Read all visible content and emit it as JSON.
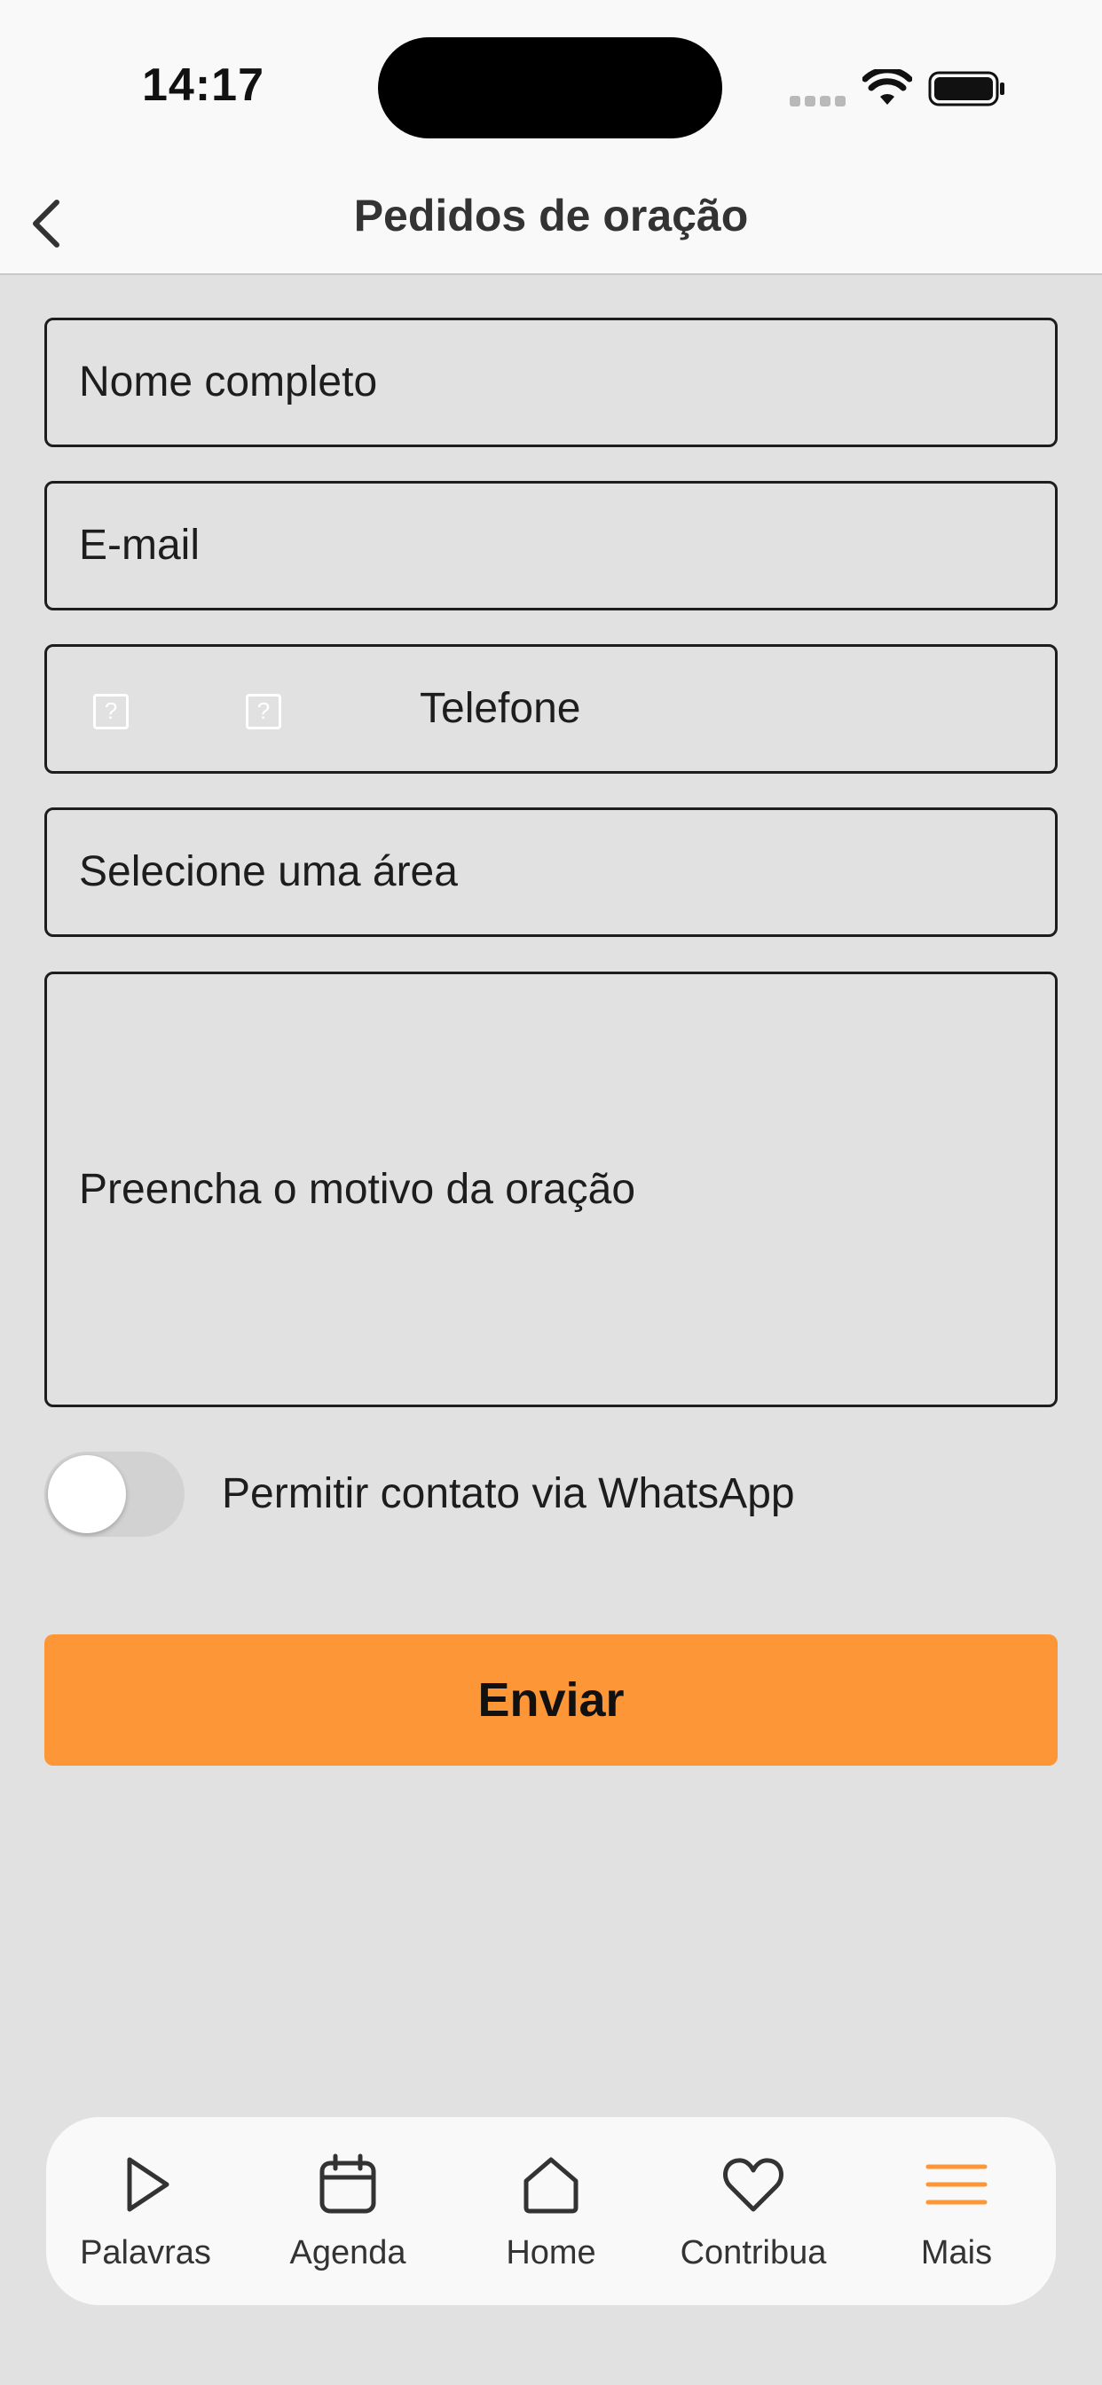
{
  "status_bar": {
    "time": "14:17"
  },
  "nav": {
    "title": "Pedidos de oração"
  },
  "form": {
    "name_placeholder": "Nome completo",
    "email_placeholder": "E-mail",
    "phone_placeholder": "Telefone",
    "area_placeholder": "Selecione uma área",
    "reason_placeholder": "Preencha o motivo da oração",
    "whatsapp_label": "Permitir contato via WhatsApp",
    "whatsapp_enabled": false,
    "submit_label": "Enviar"
  },
  "tabs": [
    {
      "label": "Palavras",
      "icon": "play-icon",
      "active": false
    },
    {
      "label": "Agenda",
      "icon": "calendar-icon",
      "active": false
    },
    {
      "label": "Home",
      "icon": "home-icon",
      "active": false
    },
    {
      "label": "Contribua",
      "icon": "heart-icon",
      "active": false
    },
    {
      "label": "Mais",
      "icon": "menu-icon",
      "active": true
    }
  ],
  "colors": {
    "accent": "#fd9637",
    "background": "#e1e1e1",
    "bar_background": "#f9f9f9",
    "text": "#1d1d1d"
  }
}
